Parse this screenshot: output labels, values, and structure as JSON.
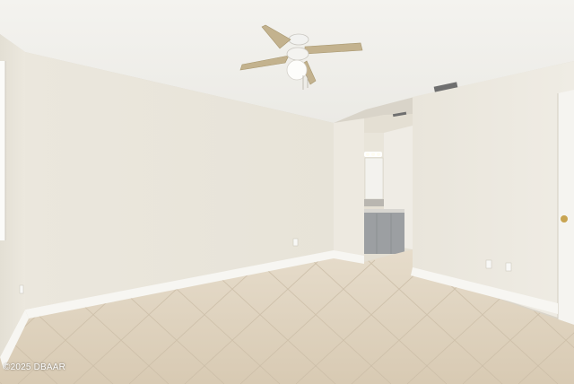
{
  "photo": {
    "description_free": true,
    "watermark": "©2025 DBAAR"
  },
  "colors": {
    "ceiling": "#f1f0ec",
    "wall_left": "#e8e4da",
    "wall_back": "#eae6dc",
    "wall_right": "#ece8df",
    "baseboard": "#f7f6f2",
    "floor": "#e0d4c1",
    "grout": "#cdbfa9",
    "vanity": "#9c9fa2",
    "door": "#f4f3ef",
    "fan_blade": "#c3b28e",
    "knob": "#c8a451"
  }
}
